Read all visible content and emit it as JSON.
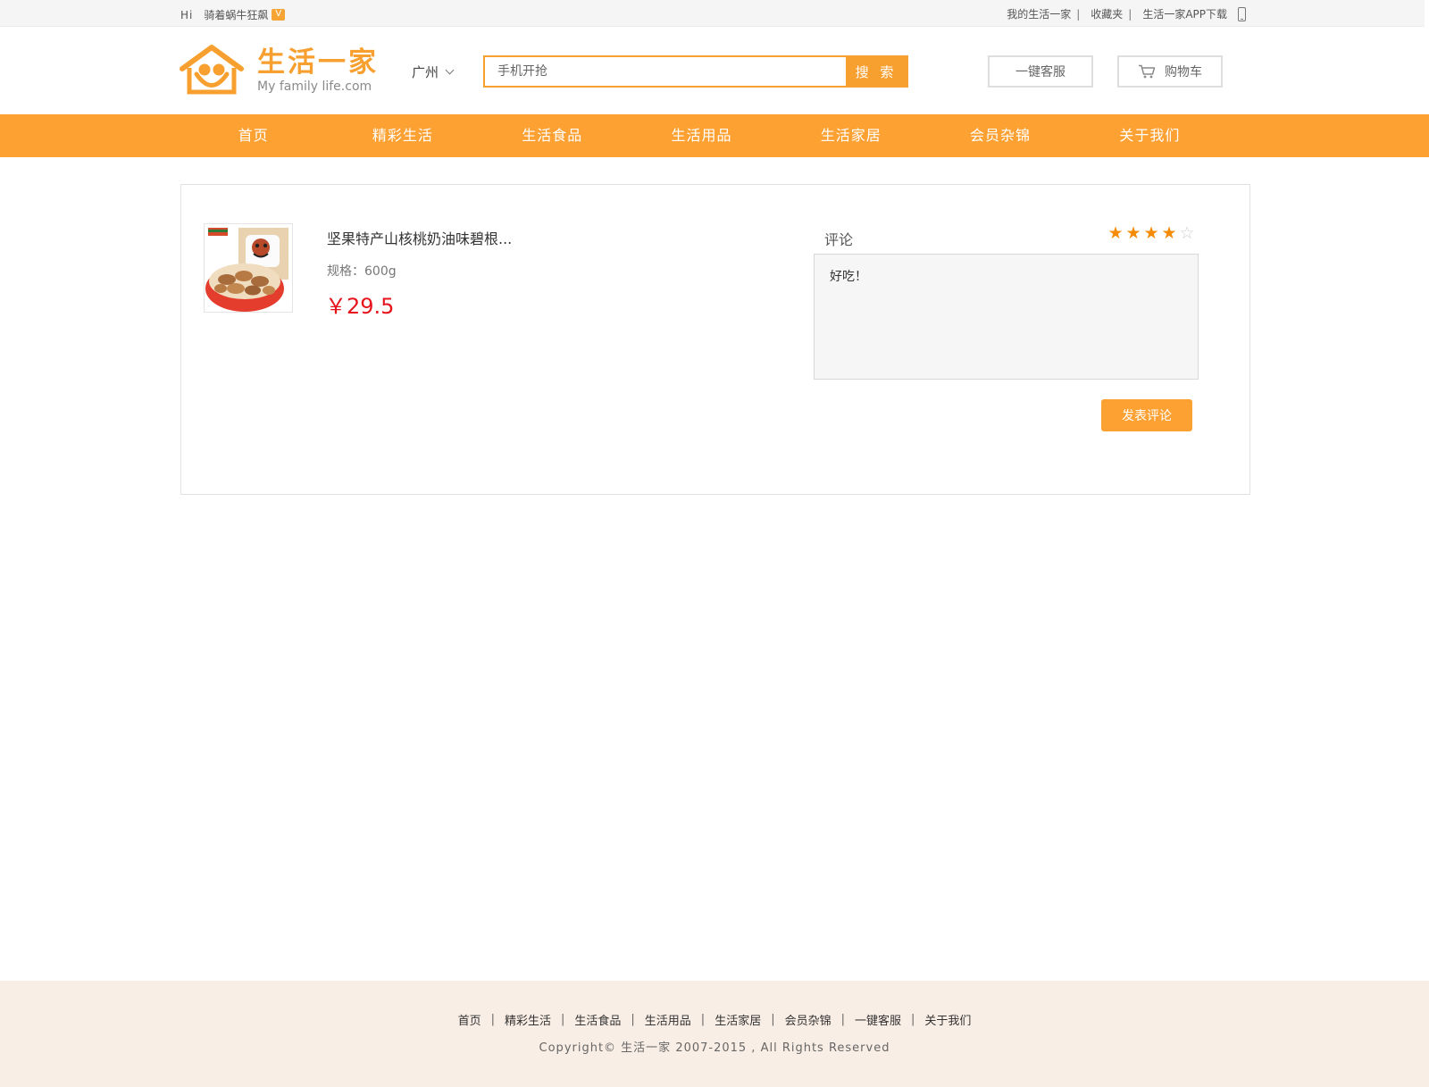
{
  "topbar": {
    "hi": "Hi",
    "username": "骑着蜗牛狂飙",
    "vip_badge": "V",
    "links": [
      "我的生活一家",
      "收藏夹",
      "生活一家APP下载"
    ],
    "separator": "|"
  },
  "header": {
    "logo_title": "生活一家",
    "logo_subtitle": "My family life.com",
    "city": "广州",
    "search_placeholder": "手机开抢",
    "search_button": "搜 索",
    "service_button": "一键客服",
    "cart_button": "购物车"
  },
  "nav": {
    "items": [
      "首页",
      "精彩生活",
      "生活食品",
      "生活用品",
      "生活家居",
      "会员杂锦",
      "关于我们"
    ]
  },
  "product": {
    "name": "坚果特产山核桃奶油味碧根...",
    "spec": "规格：600g",
    "price": "￥29.5"
  },
  "review": {
    "label": "评论",
    "rating": 4,
    "max_rating": 5,
    "star_on": "★",
    "star_off": "☆",
    "text": "好吃！",
    "submit": "发表评论"
  },
  "footer": {
    "links": [
      "首页",
      "精彩生活",
      "生活食品",
      "生活用品",
      "生活家居",
      "会员杂锦",
      "一键客服",
      "关于我们"
    ],
    "separator": "|",
    "copyright": "Copyright© 生活一家 2007-2015 , All Rights Reserved"
  },
  "colors": {
    "brand_orange": "#fda133",
    "price_red": "#e6141c",
    "star_orange": "#f58c08",
    "footer_bg": "#f9eee5"
  },
  "icons": [
    "house-logo-icon",
    "chevron-down-icon",
    "cart-icon",
    "phone-icon",
    "star-icon"
  ]
}
